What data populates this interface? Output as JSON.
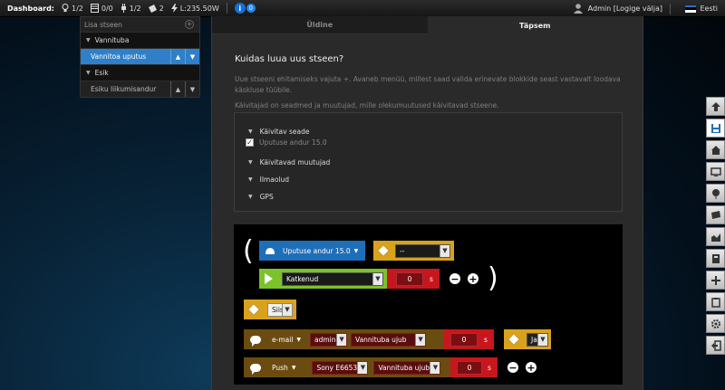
{
  "topbar": {
    "dashboard_label": "Dashboard:",
    "stats": [
      {
        "icon": "lightbulb-icon",
        "value": "1/2"
      },
      {
        "icon": "blinds-icon",
        "value": "0/0"
      },
      {
        "icon": "plug-icon",
        "value": "1/2"
      },
      {
        "icon": "sensor-icon",
        "value": "2"
      },
      {
        "icon": "lightning-icon",
        "value": "L:235.50W"
      }
    ],
    "info_badge": {
      "label": "i",
      "count": "0"
    },
    "user": "Admin [Logige välja]",
    "language": "Eesti"
  },
  "sidebar": {
    "header": "Lisa stseen",
    "groups": [
      {
        "label": "Vannituba",
        "items": [
          {
            "label": "Vannitoa uputus",
            "active": true
          }
        ]
      },
      {
        "label": "Esik",
        "items": [
          {
            "label": "Esiku liikumisandur",
            "active": false
          }
        ]
      }
    ]
  },
  "tabs": [
    {
      "label": "Üldine",
      "active": false
    },
    {
      "label": "Täpsem",
      "active": true
    }
  ],
  "main": {
    "title": "Kuidas luua uus stseen?",
    "desc1": "Uue stseeni ehitamiseks vajuta +. Avaneb menüü, millest saad valida erinevate blokkide seast vastavalt loodava käskluse tüübile.",
    "desc2": "Käivitajad on seadmed ja muutujad, mille olekumuutused käivitavad stseene."
  },
  "triggers": {
    "section1": "Käivitav seade",
    "checkbox_label": "Uputuse andur 15.0",
    "section2": "Käivitavad muutujad",
    "section3": "Ilmaolud",
    "section4": "GPS"
  },
  "builder": {
    "open_paren": "(",
    "close_paren": ")",
    "device_label": "Uputuse andur 15.0",
    "operator_value": "--",
    "state_value": "Katkenud",
    "delay1": "0",
    "unit": "s",
    "then_value": "Siis",
    "email_label": "e-mail",
    "email_user": "admin",
    "email_msg": "Vannituba ujub",
    "delay2": "0",
    "and_value": "Ja",
    "push_label": "Push",
    "push_device": "Sony E6653",
    "push_msg": "Vannituba ujub",
    "delay3": "0",
    "minus": "−",
    "plus": "+"
  },
  "right_toolbar": [
    "arrow-up-icon",
    "save-icon",
    "home-icon",
    "monitor-icon",
    "balloon-icon",
    "flag-icon",
    "chart-icon",
    "copy-icon",
    "move-icon",
    "clipboard-icon",
    "settings-icon",
    "logout-icon"
  ],
  "colors": {
    "accent_blue": "#2f7fc9",
    "gold": "#d9a21c",
    "green": "#7cc22a",
    "red": "#c8161d",
    "brown": "#6b4c10"
  }
}
